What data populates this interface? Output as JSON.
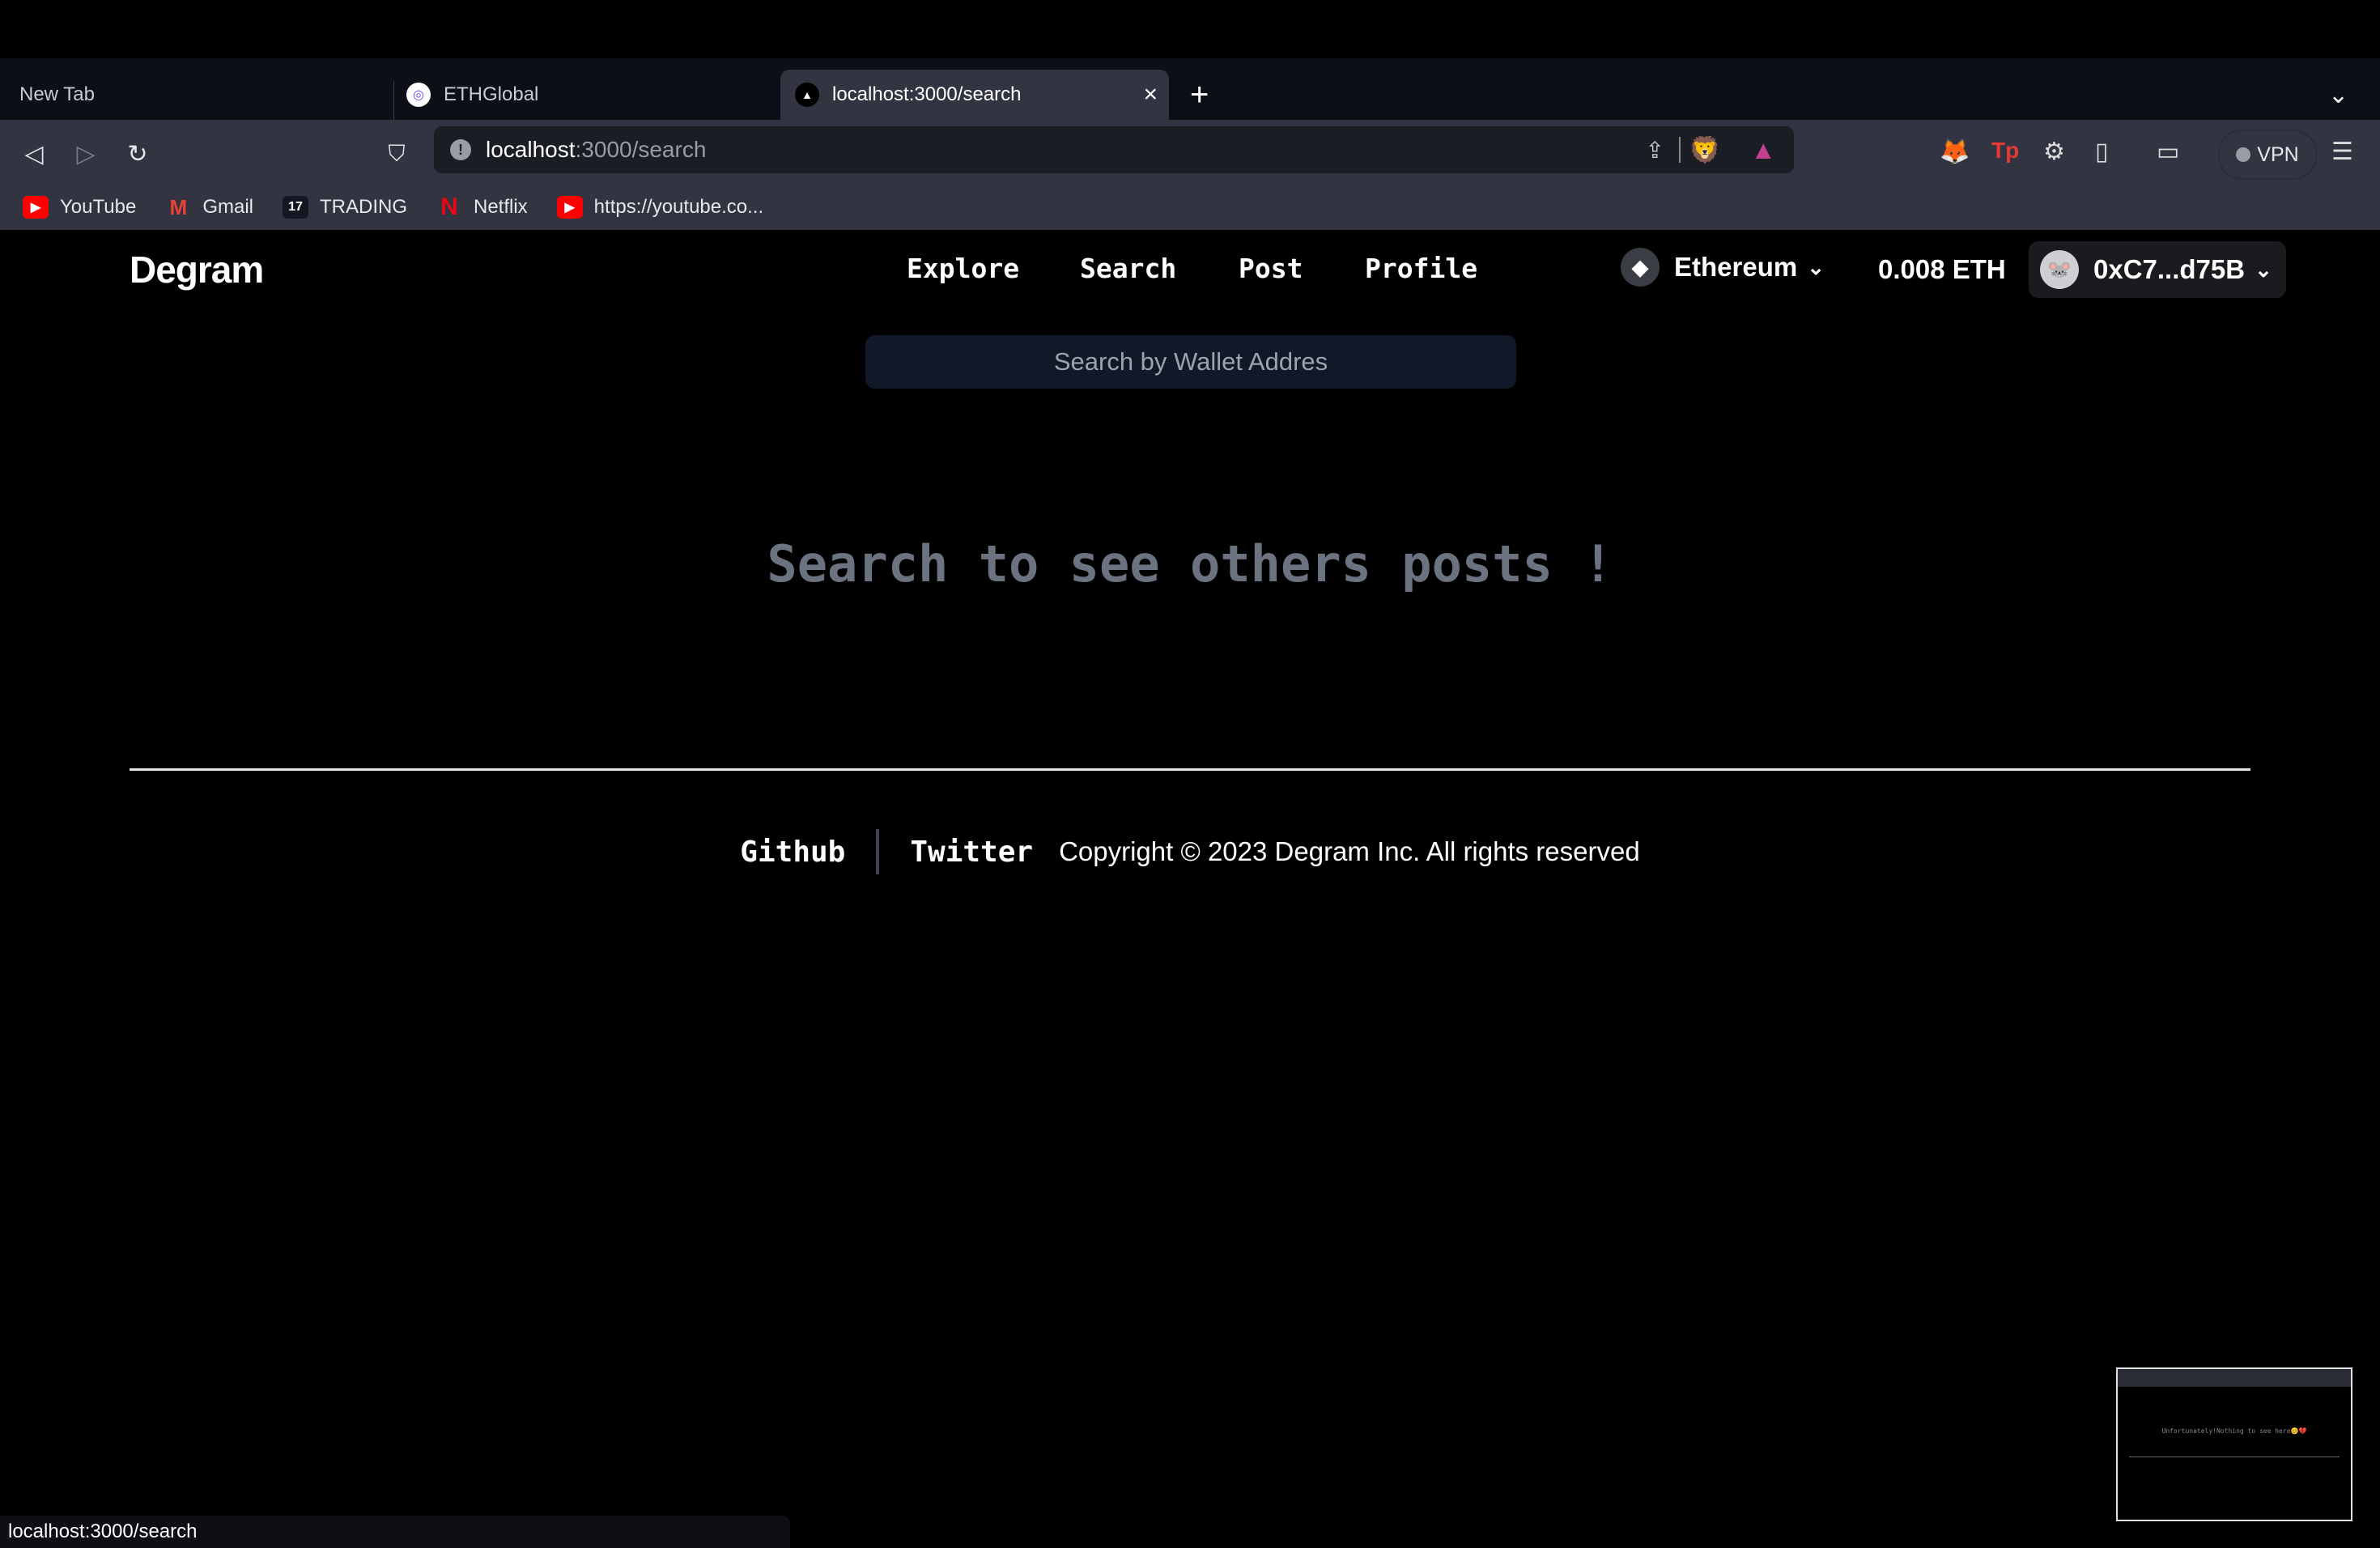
{
  "browser": {
    "tabs": [
      {
        "label": "New Tab",
        "active": false
      },
      {
        "label": "ETHGlobal",
        "active": false,
        "icon": "ethglobal-icon"
      },
      {
        "label": "localhost:3000/search",
        "active": true,
        "icon": "vercel-triangle-icon"
      }
    ],
    "new_tab_symbol": "+",
    "tab_close_symbol": "×",
    "tab_list_symbol": "⌄",
    "url_host": "localhost",
    "url_path": ":3000/search",
    "bookmarks": [
      {
        "label": "YouTube",
        "icon": "youtube-icon",
        "color": "#ff0000"
      },
      {
        "label": "Gmail",
        "icon": "gmail-icon",
        "color": "#ea4335"
      },
      {
        "label": "TRADING",
        "icon": "tradingview-icon",
        "color": "#131722"
      },
      {
        "label": "Netflix",
        "icon": "netflix-icon",
        "color": "#e50914"
      },
      {
        "label": "https://youtube.co...",
        "icon": "youtube-icon",
        "color": "#ff0000"
      }
    ],
    "vpn_label": "VPN",
    "status_url": "localhost:3000/search"
  },
  "app": {
    "logo": "Degram",
    "nav": [
      "Explore",
      "Search",
      "Post",
      "Profile"
    ],
    "network": "Ethereum",
    "balance": "0.008 ETH",
    "account": "0xC7...d75B",
    "search_placeholder": "Search by Wallet Addres",
    "empty_message": "Search to see others posts !",
    "footer": {
      "links": [
        "Github",
        "Twitter"
      ],
      "copyright": "Copyright © 2023 Degram Inc. All rights reserved"
    }
  },
  "thumbnail": {
    "message": "Unfortunately!Nothing to see here😊💔"
  },
  "colors": {
    "page_bg": "#000000",
    "muted_text": "#6b7280",
    "input_bg": "#111827",
    "chrome_toolbar": "#323541"
  }
}
